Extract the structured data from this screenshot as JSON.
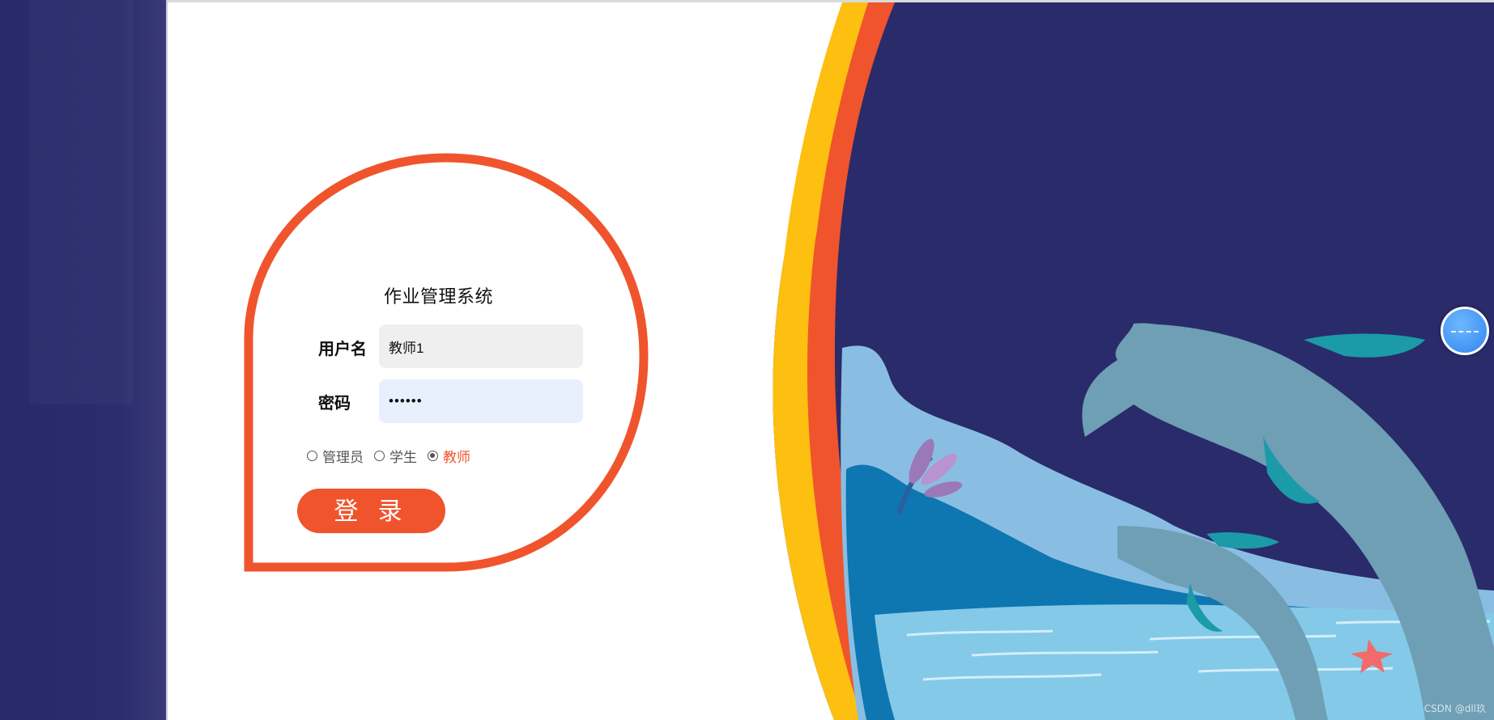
{
  "login": {
    "title": "作业管理系统",
    "username_label": "用户名",
    "password_label": "密码",
    "username_value": "教师1",
    "password_value": "••••••",
    "roles": [
      {
        "label": "管理员",
        "checked": false
      },
      {
        "label": "学生",
        "checked": false
      },
      {
        "label": "教师",
        "checked": true
      }
    ],
    "login_button": "登 录"
  },
  "watermark": "CSDN @dll玖",
  "colors": {
    "accent": "#f0542d",
    "yellow": "#fdbf10",
    "night": "#2a2b6b",
    "sea": "#8ec6e6",
    "dolphin": "#6e9fb5"
  },
  "icons": {
    "float_button": "floating-assistant-icon"
  }
}
